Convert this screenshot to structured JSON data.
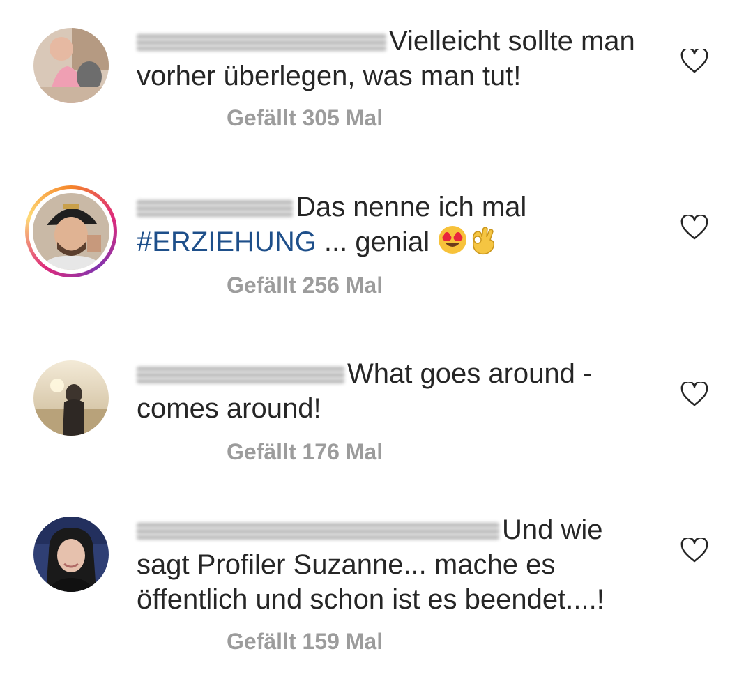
{
  "comments": [
    {
      "text_after_name": "Vielleicht sollte man",
      "text_line2": "vorher überlegen, was man tut!",
      "likes": "Gefällt 305 Mal"
    },
    {
      "text_after_name": "Das nenne ich mal",
      "hashtag": "#ERZIEHUNG",
      "text_line2_rest": " ... genial ",
      "likes": "Gefällt 256 Mal"
    },
    {
      "text_after_name": "What goes around -",
      "text_line2": "comes around!",
      "likes": "Gefällt 176 Mal"
    },
    {
      "text_after_name": "Und wie",
      "text_line2": "sagt Profiler Suzanne... mache es",
      "text_line3": "öffentlich und schon ist es beendet....!",
      "likes": "Gefällt 159 Mal"
    }
  ],
  "icons": {
    "like": "heart-outline-icon",
    "emoji1": "heart-eyes-emoji",
    "emoji2": "ok-hand-emoji"
  }
}
